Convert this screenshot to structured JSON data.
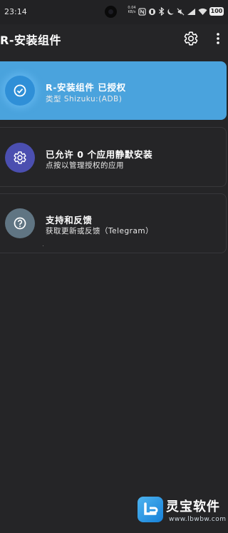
{
  "status_bar": {
    "time": "23:14",
    "net_speed": "0.04 KB/s",
    "battery": "100",
    "icons": [
      "nfc-icon",
      "vibrate-icon",
      "bluetooth-icon",
      "moon-icon",
      "mute-icon",
      "signal-icon",
      "wifi-icon",
      "battery-icon"
    ]
  },
  "app_bar": {
    "title": "R-安装组件",
    "settings_icon": "gear-icon",
    "more_icon": "more-vert-icon"
  },
  "cards": {
    "status": {
      "title": "R-安装组件 已授权",
      "subtitle": "类型 Shizuku:(ADB)",
      "icon": "check-circle-icon",
      "color": "#4aa3dd"
    },
    "apps": {
      "title": "已允许 0 个应用静默安装",
      "subtitle": "点按以管理授权的应用",
      "icon": "gear-icon",
      "color": "#4b4fb0"
    },
    "support": {
      "title": "支持和反馈",
      "subtitle": "获取更新或反馈（Telegram）",
      "icon": "help-circle-icon",
      "color": "#607583"
    }
  },
  "watermark": {
    "name": "灵宝软件",
    "url": "www.lbwbw.com"
  }
}
